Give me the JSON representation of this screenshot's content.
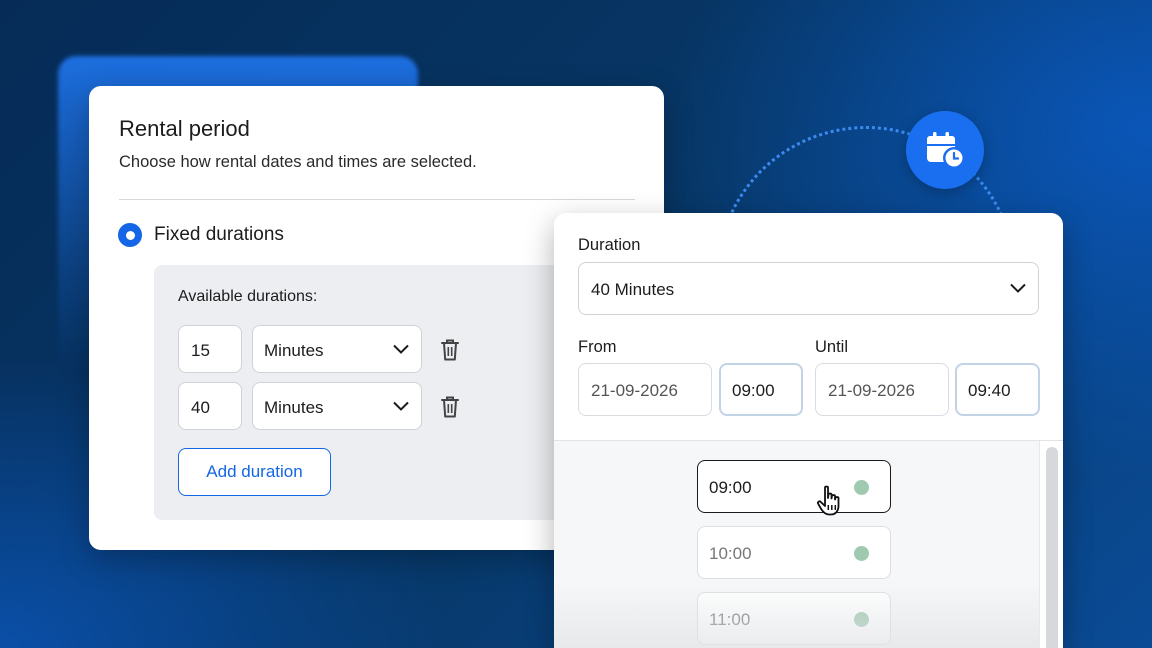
{
  "rental": {
    "title": "Rental period",
    "subtitle": "Choose how rental dates and times are selected.",
    "mode_label": "Fixed durations",
    "available_label": "Available durations:",
    "durations": [
      {
        "amount": "15",
        "unit": "Minutes"
      },
      {
        "amount": "40",
        "unit": "Minutes"
      }
    ],
    "add_label": "Add duration"
  },
  "booking": {
    "duration_label": "Duration",
    "duration_value": "40 Minutes",
    "from_label": "From",
    "from_date": "21-09-2026",
    "from_time": "09:00",
    "until_label": "Until",
    "until_date": "21-09-2026",
    "until_time": "09:40",
    "slots": [
      "09:00",
      "10:00",
      "11:00"
    ]
  },
  "colors": {
    "accent": "#1466e6",
    "available_dot": "#9fcab0"
  },
  "icons": {
    "badge": "calendar-clock-icon",
    "delete": "trash-icon",
    "dropdown": "chevron-down-icon",
    "pointer": "hand-pointer-icon"
  }
}
